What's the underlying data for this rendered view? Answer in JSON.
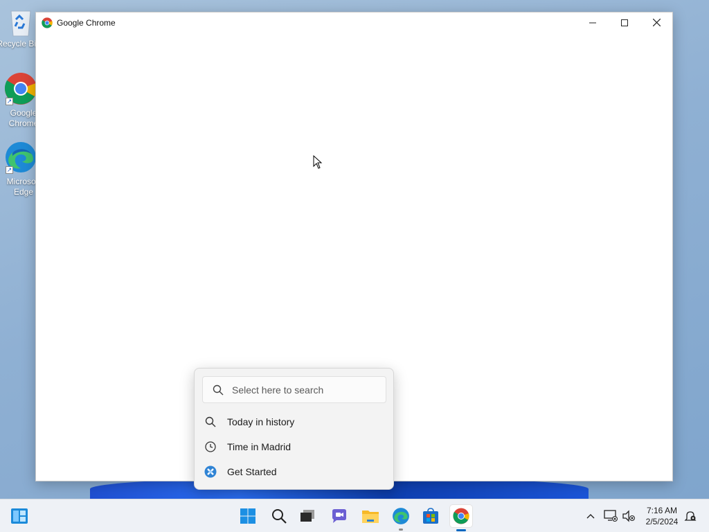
{
  "desktop": {
    "icons": [
      {
        "label": "Recycle Bin",
        "icon": "recycle-bin-icon"
      },
      {
        "label": "Google Chrome",
        "icon": "chrome-icon"
      },
      {
        "label": "Microsoft Edge",
        "icon": "edge-icon"
      }
    ]
  },
  "window": {
    "title": "Google Chrome",
    "icon": "chrome-icon"
  },
  "search_flyout": {
    "placeholder": "Select here to search",
    "items": [
      {
        "label": "Today in history",
        "icon": "search-icon"
      },
      {
        "label": "Time in Madrid",
        "icon": "clock-icon"
      },
      {
        "label": "Get Started",
        "icon": "get-started-icon"
      }
    ]
  },
  "taskbar": {
    "pinned": [
      "widgets-icon",
      "start-icon",
      "search-icon",
      "task-view-icon",
      "chat-icon",
      "file-explorer-icon",
      "edge-icon",
      "store-icon",
      "chrome-icon"
    ],
    "time": "7:16 AM",
    "date": "2/5/2024"
  },
  "colors": {
    "accent": "#0067c0",
    "taskbar": "#eef1f6"
  }
}
